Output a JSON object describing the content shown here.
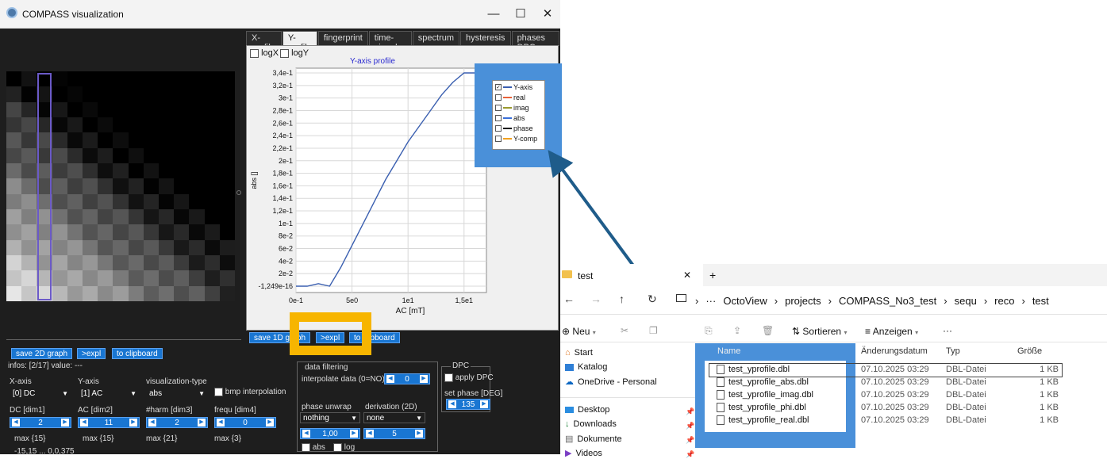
{
  "window": {
    "title": "COMPASS visualization",
    "minimize": "—",
    "maximize": "☐",
    "close": "✕"
  },
  "tabs": [
    "X-profile",
    "Y-profile",
    "fingerprint",
    "time-signal",
    "spectrum",
    "hysteresis",
    "phases DPC"
  ],
  "plot_options": {
    "logx": "logX",
    "logy": "logY"
  },
  "chart_data": {
    "type": "line",
    "title": "Y-axis profile",
    "xlabel": "AC [mT]",
    "ylabel": "abs []",
    "x_ticks": [
      "0e-1",
      "5e0",
      "1e1",
      "1,5e1"
    ],
    "y_ticks": [
      "3,4e-1",
      "3,2e-1",
      "3e-1",
      "2,8e-1",
      "2,6e-1",
      "2,4e-1",
      "2,2e-1",
      "2e-1",
      "1,8e-1",
      "1,6e-1",
      "1,4e-1",
      "1,2e-1",
      "1e-1",
      "8e-2",
      "6e-2",
      "4e-2",
      "2e-2",
      "-1,249e-16"
    ],
    "xlim": [
      0,
      17
    ],
    "ylim": [
      0,
      0.34
    ],
    "legend_position": "top-right",
    "legend": [
      {
        "name": "Y-axis",
        "color": "#3a5fb0",
        "checked": true
      },
      {
        "name": "real",
        "color": "#e8623a",
        "checked": false
      },
      {
        "name": "imag",
        "color": "#9a9a2e",
        "checked": false
      },
      {
        "name": "abs",
        "color": "#3a6fd8",
        "checked": false
      },
      {
        "name": "phase",
        "color": "#111111",
        "checked": false
      },
      {
        "name": "Y-comp",
        "color": "#f0a020",
        "checked": false
      }
    ],
    "series": [
      {
        "name": "Y-axis",
        "x": [
          0,
          1,
          2,
          3,
          4,
          5,
          6,
          7,
          8,
          9,
          10,
          11,
          12,
          13,
          14,
          15,
          16,
          17
        ],
        "y": [
          0.0,
          0.0,
          0.004,
          0.0,
          0.03,
          0.065,
          0.1,
          0.135,
          0.17,
          0.2,
          0.23,
          0.255,
          0.28,
          0.305,
          0.325,
          0.345,
          0.36,
          0.375
        ]
      }
    ]
  },
  "left_buttons": {
    "save": "save 2D graph",
    "expl": ">expl",
    "clipboard": "to clipboard"
  },
  "right_buttons": {
    "save": "save 1D graph",
    "expl": ">expl",
    "clipboard": "to clipboard"
  },
  "info": "infos: [2/17] value: ---",
  "controls": {
    "xaxis_label": "X-axis",
    "xaxis_value": "[0] DC",
    "yaxis_label": "Y-axis",
    "yaxis_value": "[1] AC",
    "vistype_label": "visualization-type",
    "vistype_value": "abs",
    "bmp": "bmp interpolation",
    "dim1_label": "DC [dim1]",
    "dim1_value": "2",
    "dim2_label": "AC [dim2]",
    "dim2_value": "11",
    "dim3_label": "#harm [dim3]",
    "dim3_value": "2",
    "dim4_label": "frequ [dim4]",
    "dim4_value": "0",
    "max1": "max {15}",
    "max2": "max {15}",
    "max3": "max {21}",
    "max4": "max {3}",
    "bottom_text": "-15,15 ... 0,0,375"
  },
  "filtering": {
    "title": "data filtering",
    "interp_label": "interpolate data (0=NO)",
    "interp_value": "0",
    "unwrap_label": "phase unwrap",
    "unwrap_value": "nothing",
    "deriv_label": "derivation (2D)",
    "deriv_value": "none",
    "spin1": "1,00",
    "spin2": "5",
    "abs": "abs",
    "log": "log"
  },
  "dpc": {
    "title": "DPC",
    "apply": "apply DPC",
    "phase_label": "set phase [DEG]",
    "phase_value": "135"
  },
  "explorer": {
    "tab_title": "test",
    "tab_close": "✕",
    "tab_add": "+",
    "breadcrumb": [
      "OctoView",
      "projects",
      "COMPASS_No3_test",
      "sequ",
      "reco",
      "test"
    ],
    "toolbar": {
      "new": "Neu",
      "sort": "Sortieren",
      "view": "Anzeigen",
      "more": "···"
    },
    "sidebar": [
      "Start",
      "Katalog",
      "OneDrive - Personal",
      "Desktop",
      "Downloads",
      "Dokumente",
      "Videos"
    ],
    "columns": {
      "name": "Name",
      "date": "Änderungsdatum",
      "type": "Typ",
      "size": "Größe"
    },
    "files": [
      {
        "name": "test_yprofile.dbl",
        "date": "07.10.2025 03:29",
        "type": "DBL-Datei",
        "size": "1 KB"
      },
      {
        "name": "test_yprofile_abs.dbl",
        "date": "07.10.2025 03:29",
        "type": "DBL-Datei",
        "size": "1 KB"
      },
      {
        "name": "test_yprofile_imag.dbl",
        "date": "07.10.2025 03:29",
        "type": "DBL-Datei",
        "size": "1 KB"
      },
      {
        "name": "test_yprofile_phi.dbl",
        "date": "07.10.2025 03:29",
        "type": "DBL-Datei",
        "size": "1 KB"
      },
      {
        "name": "test_yprofile_real.dbl",
        "date": "07.10.2025 03:29",
        "type": "DBL-Datei",
        "size": "1 KB"
      }
    ]
  },
  "colors": {
    "highlight_blue": "#4a90d9",
    "highlight_yellow": "#f7b500",
    "arrow": "#1f5c8a"
  }
}
